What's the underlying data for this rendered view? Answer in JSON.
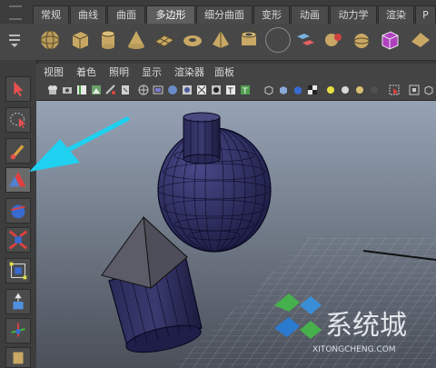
{
  "shelf_tabs": [
    "常规",
    "曲线",
    "曲面",
    "多边形",
    "细分曲面",
    "变形",
    "动画",
    "动力学",
    "渲染",
    "P"
  ],
  "active_tab": "多边形",
  "panel_menu": [
    "视图",
    "着色",
    "照明",
    "显示",
    "渲染器",
    "面板"
  ],
  "watermark": {
    "name": "系统城",
    "url": "XITONGCHENG.COM"
  },
  "colors": {
    "arrow": "#1fd0f0",
    "mesh_fill": "#2a2a55",
    "mesh_line": "#0a0a22",
    "accent": "#4fc0e8"
  },
  "shelf_icons": [
    "sphere-icon",
    "cube-icon",
    "cylinder-icon",
    "cone-icon",
    "plane-icon",
    "torus-icon",
    "pyramid-icon",
    "pipe-icon",
    "helix-icon",
    "soccer-ball-icon",
    "combine-icon",
    "separate-icon",
    "extract-icon",
    "smooth-icon",
    "boolean-icon",
    "plane2-icon"
  ]
}
